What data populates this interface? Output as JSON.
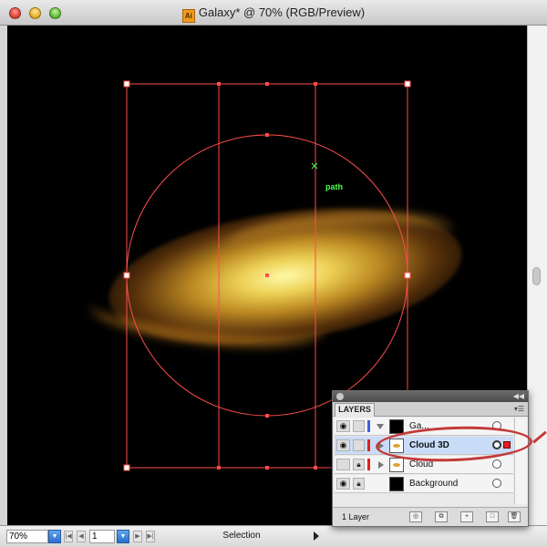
{
  "window": {
    "title": "Galaxy* @ 70% (RGB/Preview)",
    "app_icon_label": "Ai"
  },
  "canvas": {
    "path_label": "path"
  },
  "statusbar": {
    "zoom": "70%",
    "page": "1",
    "tool": "Selection"
  },
  "layers_panel": {
    "tab": "LAYERS",
    "rows": [
      {
        "name": "Ga...",
        "color": "#3a5fd8",
        "expanded": true
      },
      {
        "name": "Cloud 3D",
        "color": "#e02020",
        "selected": true
      },
      {
        "name": "Cloud",
        "color": "#e02020"
      },
      {
        "name": "Background",
        "color": ""
      }
    ],
    "count": "1 Layer"
  },
  "colors": {
    "selection": "#ff4d4d",
    "path_label": "#4cff4c",
    "highlight": "#c43a3a"
  }
}
